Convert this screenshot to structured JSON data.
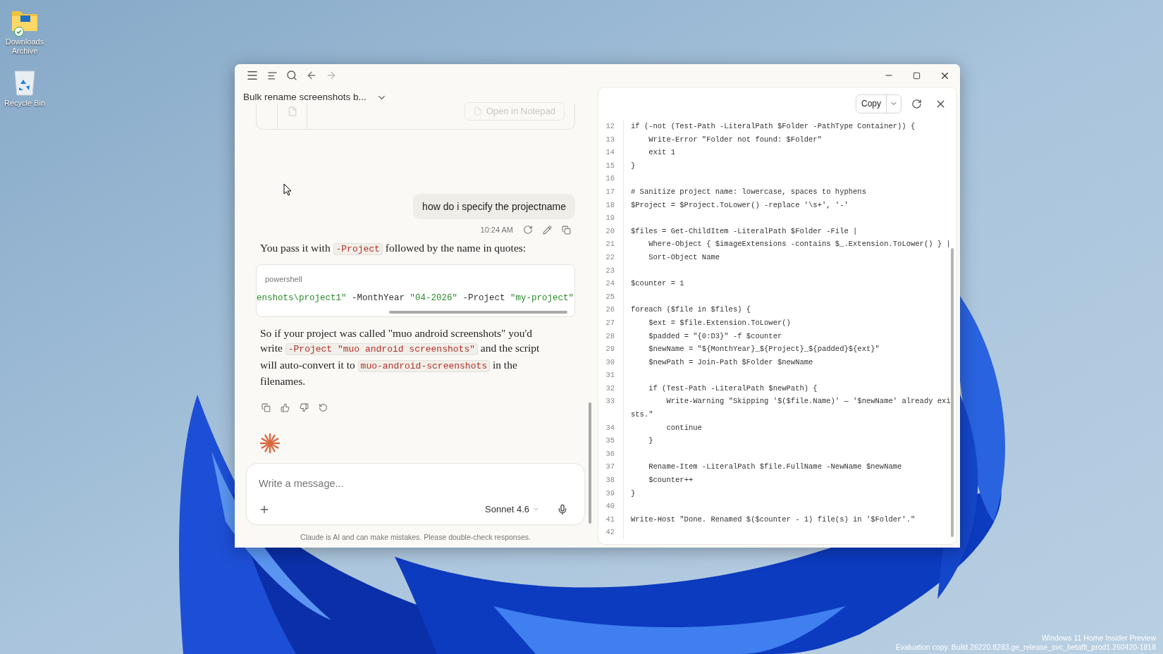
{
  "desktop_icons": [
    {
      "label": "Downloads Archive",
      "synced": true
    },
    {
      "label": "Recycle Bin",
      "synced": false
    }
  ],
  "window": {
    "conversation_title": "Bulk rename screenshots b...",
    "chat": {
      "attachment_action": "Open in Notepad",
      "user_message": "how do i specify the projectname",
      "timestamp": "10:24 AM",
      "reply_intro": [
        {
          "kind": "text",
          "text": "You pass it with "
        },
        {
          "kind": "code",
          "text": "-Project"
        },
        {
          "kind": "text",
          "text": " followed by the name in quotes:"
        }
      ],
      "code_block": {
        "language": "powershell",
        "segments": [
          {
            "kind": "string",
            "text": "enshots\\project1\""
          },
          {
            "kind": "plain",
            "text": " -MonthYear "
          },
          {
            "kind": "string",
            "text": "\"04-2026\""
          },
          {
            "kind": "plain",
            "text": " -Project "
          },
          {
            "kind": "string",
            "text": "\"my-project\""
          }
        ]
      },
      "reply_followup": [
        {
          "kind": "text",
          "text": "So if your project was called \"muo android screenshots\" you'd write "
        },
        {
          "kind": "code",
          "text": "-Project \"muo android screenshots\""
        },
        {
          "kind": "text",
          "text": " and the script will auto-convert it to "
        },
        {
          "kind": "code",
          "text": "muo-android-screenshots"
        },
        {
          "kind": "text",
          "text": " in the filenames."
        }
      ],
      "composer": {
        "placeholder": "Write a message...",
        "model": "Sonnet 4.6"
      },
      "disclaimer": "Claude is AI and can make mistakes. Please double-check responses."
    },
    "artifact": {
      "copy_label": "Copy",
      "lines": [
        {
          "number": "12",
          "text": "if (-not (Test-Path -LiteralPath $Folder -PathType Container)) {"
        },
        {
          "number": "13",
          "text": "    Write-Error \"Folder not found: $Folder\""
        },
        {
          "number": "14",
          "text": "    exit 1"
        },
        {
          "number": "15",
          "text": "}"
        },
        {
          "number": "16"
        },
        {
          "number": "17",
          "text": "# Sanitize project name: lowercase, spaces to hyphens"
        },
        {
          "number": "18",
          "text": "$Project = $Project.ToLower() -replace '\\s+', '-'"
        },
        {
          "number": "19"
        },
        {
          "number": "20",
          "text": "$files = Get-ChildItem -LiteralPath $Folder -File |"
        },
        {
          "number": "21",
          "text": "    Where-Object { $imageExtensions -contains $_.Extension.ToLower() } |"
        },
        {
          "number": "22",
          "text": "    Sort-Object Name"
        },
        {
          "number": "23"
        },
        {
          "number": "24",
          "text": "$counter = 1"
        },
        {
          "number": "25"
        },
        {
          "number": "26",
          "text": "foreach ($file in $files) {"
        },
        {
          "number": "27",
          "text": "    $ext = $file.Extension.ToLower()"
        },
        {
          "number": "28",
          "text": "    $padded = \"{0:D3}\" -f $counter"
        },
        {
          "number": "29",
          "text": "    $newName = \"${MonthYear}_${Project}_${padded}${ext}\""
        },
        {
          "number": "30",
          "text": "    $newPath = Join-Path $Folder $newName"
        },
        {
          "number": "31"
        },
        {
          "number": "32",
          "text": "    if (Test-Path -LiteralPath $newPath) {"
        },
        {
          "number": "33",
          "text": "        Write-Warning \"Skipping '$($file.Name)' — '$newName' already exists.\""
        },
        {
          "number": "34",
          "text": "        continue"
        },
        {
          "number": "35",
          "text": "    }"
        },
        {
          "number": "36"
        },
        {
          "number": "37",
          "text": "    Rename-Item -LiteralPath $file.FullName -NewName $newName"
        },
        {
          "number": "38",
          "text": "    $counter++"
        },
        {
          "number": "39",
          "text": "}"
        },
        {
          "number": "40"
        },
        {
          "number": "41",
          "text": "Write-Host \"Done. Renamed $($counter - 1) file(s) in '$Folder'.\""
        },
        {
          "number": "42"
        }
      ]
    }
  },
  "watermark_text": [
    "Windows 11 Home Insider Preview",
    "Evaluation copy. Build 26220.8283.ge_release_svc_betaflt_prod1.260420-1818"
  ]
}
